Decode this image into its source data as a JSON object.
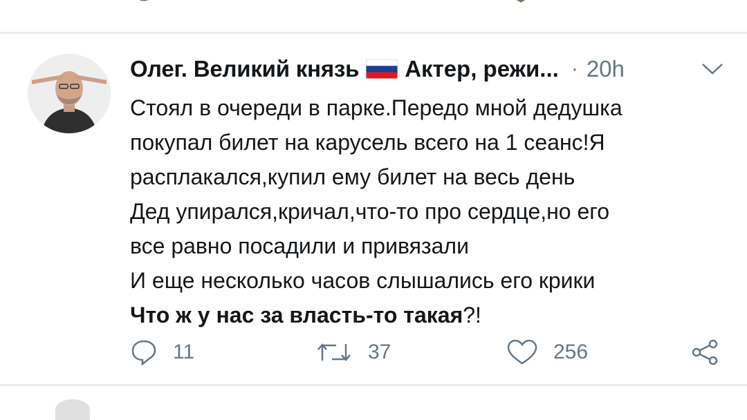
{
  "tweet": {
    "author_name": "Олег. Великий князь",
    "author_suffix": "Актер, режи...",
    "separator": "·",
    "time": "20h",
    "lines": [
      "Стоял в очереди в парке.Передо мной дедушка",
      "покупал билет на карусель всего на 1 сеанс!Я",
      "расплакался,купил ему билет на весь день",
      "Дед упирался,кричал,что-то про сердце,но его",
      "все равно посадили и привязали",
      "И еще несколько часов слышались его крики"
    ],
    "bold_line": "Что ж у нас за власть-то такая",
    "bold_line_tail": "?!",
    "reply_count": "11",
    "retweet_count": "37",
    "like_count": "256"
  },
  "icons": {
    "reply": "reply-icon",
    "retweet": "retweet-icon",
    "like": "heart-icon",
    "share": "share-icon",
    "menu": "chevron-down-icon",
    "flag": "russia-flag-icon"
  },
  "colors": {
    "text": "#14171a",
    "secondary": "#657786",
    "divider": "#e6ecf0",
    "flag_white": "#ffffff",
    "flag_blue": "#1c3f94",
    "flag_red": "#e4181c"
  }
}
